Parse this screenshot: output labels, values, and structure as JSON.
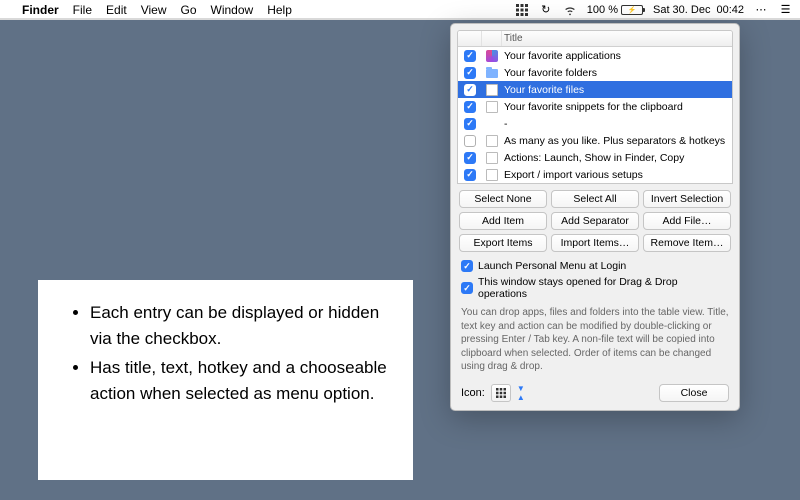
{
  "menubar": {
    "app": "Finder",
    "items": [
      "File",
      "Edit",
      "View",
      "Go",
      "Window",
      "Help"
    ],
    "battery_pct": "100 %",
    "date": "Sat 30. Dec",
    "time": "00:42"
  },
  "info_card": {
    "bullet1": "Each entry can be displayed or hidden via the checkbox.",
    "bullet2": "Has title, text, hotkey and a chooseable action when selected as menu option."
  },
  "prefs": {
    "header": {
      "title": "Title"
    },
    "rows": [
      {
        "checked": true,
        "icon": "app-icon",
        "title": "Your favorite applications",
        "selected": false
      },
      {
        "checked": true,
        "icon": "folder-icon",
        "title": "Your favorite folders",
        "selected": false
      },
      {
        "checked": true,
        "icon": "file-icon",
        "title": "Your favorite files",
        "selected": true
      },
      {
        "checked": true,
        "icon": "doc-icon",
        "title": "Your favorite snippets for the clipboard",
        "selected": false
      },
      {
        "checked": true,
        "icon": "",
        "title": "-",
        "selected": false
      },
      {
        "checked": false,
        "icon": "doc-icon",
        "title": "As many as you like. Plus separators & hotkeys",
        "selected": false
      },
      {
        "checked": true,
        "icon": "doc-icon",
        "title": "Actions: Launch, Show in Finder, Copy",
        "selected": false
      },
      {
        "checked": true,
        "icon": "doc-icon",
        "title": "Export / import various setups",
        "selected": false
      }
    ],
    "buttons": {
      "select_none": "Select None",
      "select_all": "Select All",
      "invert_selection": "Invert Selection",
      "add_item": "Add Item",
      "add_separator": "Add Separator",
      "add_file": "Add File…",
      "export_items": "Export Items",
      "import_items": "Import Items…",
      "remove_item": "Remove Item…"
    },
    "launch_at_login": "Launch Personal Menu at Login",
    "stays_open": "This window stays opened for Drag & Drop operations",
    "help_text": "You can drop apps, files and folders into the table view. Title, text key and action can be modified by double-clicking or pressing Enter / Tab key. A non-file text will be copied into clipboard when selected. Order of items can be changed using drag & drop.",
    "icon_label": "Icon:",
    "close": "Close"
  }
}
